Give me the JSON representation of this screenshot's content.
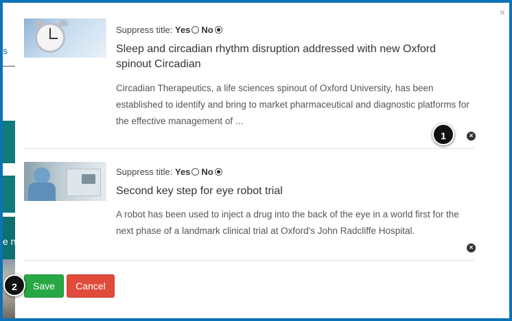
{
  "background": {
    "fragment_top": "s",
    "fragment_bottom": "e n"
  },
  "modal": {
    "close_label": "×"
  },
  "news_items": [
    {
      "suppress_label": "Suppress title:",
      "yes_label": "Yes",
      "no_label": "No",
      "suppress_title_selected": "No",
      "title": "Sleep and circadian rhythm disruption addressed with new Oxford spinout Circadian",
      "summary": "Circadian Therapeutics, a life sciences spinout of Oxford University, has been established to identify and bring to market pharmaceutical and diagnostic platforms for the effective management of ...",
      "remove_icon": "×"
    },
    {
      "suppress_label": "Suppress title:",
      "yes_label": "Yes",
      "no_label": "No",
      "suppress_title_selected": "No",
      "title": "Second key step for eye robot trial",
      "summary": "A robot has been used to inject a drug into the back of the eye in a world first for the next phase of a landmark clinical trial at Oxford's John Radcliffe Hospital.",
      "remove_icon": "×"
    }
  ],
  "buttons": {
    "save_label": "Save",
    "cancel_label": "Cancel"
  },
  "callouts": [
    "1",
    "2"
  ],
  "colors": {
    "frame_blue": "#0a73b7",
    "save_green": "#28a745",
    "cancel_red": "#e04b3c",
    "background_teal": "#117a7a"
  }
}
